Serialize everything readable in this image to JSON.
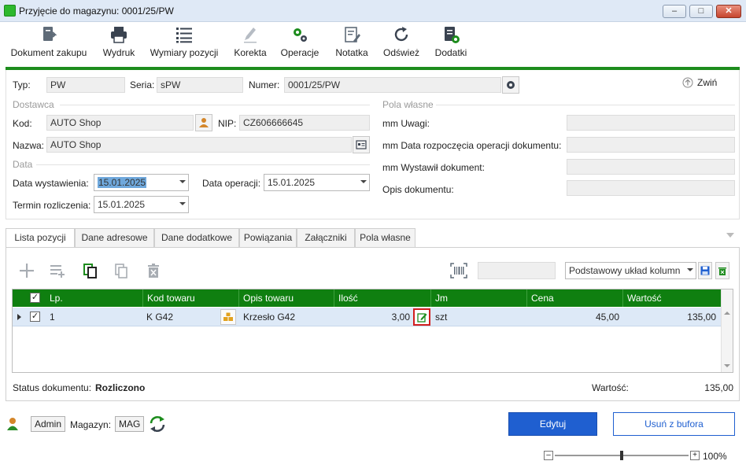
{
  "window": {
    "title": "Przyjęcie do magazynu: 0001/25/PW",
    "buttons": [
      "minimize",
      "maximize",
      "close"
    ]
  },
  "toolbar": {
    "items": [
      {
        "label": "Dokument zakupu",
        "icon": "document-export-icon"
      },
      {
        "label": "Wydruk",
        "icon": "printer-icon"
      },
      {
        "label": "Wymiary pozycji",
        "icon": "list-icon"
      },
      {
        "label": "Korekta",
        "icon": "pencil-icon"
      },
      {
        "label": "Operacje",
        "icon": "gears-icon"
      },
      {
        "label": "Notatka",
        "icon": "note-icon"
      },
      {
        "label": "Odśwież",
        "icon": "refresh-icon"
      },
      {
        "label": "Dodatki",
        "icon": "addons-icon"
      }
    ]
  },
  "header": {
    "typ_label": "Typ:",
    "typ_value": "PW",
    "seria_label": "Seria:",
    "seria_value": "sPW",
    "numer_label": "Numer:",
    "numer_value": "0001/25/PW",
    "collapse_label": "Zwiń",
    "dostawca_section": "Dostawca",
    "kod_label": "Kod:",
    "kod_value": "AUTO Shop",
    "nip_label": "NIP:",
    "nip_value": "CZ606666645",
    "nazwa_label": "Nazwa:",
    "nazwa_value": "AUTO Shop",
    "data_section": "Data",
    "data_wyst_label": "Data wystawienia:",
    "data_wyst_value": "15.01.2025",
    "data_oper_label": "Data operacji:",
    "data_oper_value": "15.01.2025",
    "termin_label": "Termin rozliczenia:",
    "termin_value": "15.01.2025",
    "pola_section": "Pola własne",
    "pola": [
      {
        "label": "mm Uwagi:",
        "value": ""
      },
      {
        "label": "mm Data rozpoczęcia operacji dokumentu:",
        "value": ""
      },
      {
        "label": "mm Wystawił dokument:",
        "value": ""
      },
      {
        "label": "Opis dokumentu:",
        "value": ""
      }
    ]
  },
  "tabs": [
    {
      "label": "Lista pozycji",
      "active": true
    },
    {
      "label": "Dane adresowe",
      "active": false
    },
    {
      "label": "Dane dodatkowe",
      "active": false
    },
    {
      "label": "Powiązania",
      "active": false
    },
    {
      "label": "Załączniki",
      "active": false
    },
    {
      "label": "Pola własne",
      "active": false
    }
  ],
  "grid_toolbar": {
    "search_value": "",
    "layout_value": "Podstawowy układ kolumn"
  },
  "grid": {
    "columns": [
      "Lp.",
      "Kod towaru",
      "Opis towaru",
      "Ilość",
      "Jm",
      "Cena",
      "Wartość"
    ],
    "rows": [
      {
        "lp": "1",
        "kod": "K G42",
        "opis": "Krzesło G42",
        "ilosc": "3,00",
        "jm": "szt",
        "cena": "45,00",
        "wartosc": "135,00",
        "checked": true
      }
    ]
  },
  "status": {
    "label": "Status dokumentu:",
    "value": "Rozliczono",
    "wartosc_label": "Wartość:",
    "wartosc_value": "135,00"
  },
  "footer": {
    "user": "Admin",
    "magazyn_label": "Magazyn:",
    "magazyn_value": "MAG",
    "edit_button": "Edytuj",
    "remove_button": "Usuń z bufora",
    "zoom": "100%",
    "zoom_level": 0.5
  },
  "colors": {
    "accent_green": "#0f7f10",
    "primary_blue": "#1f5fd0",
    "highlight_red": "#d21f1f"
  }
}
